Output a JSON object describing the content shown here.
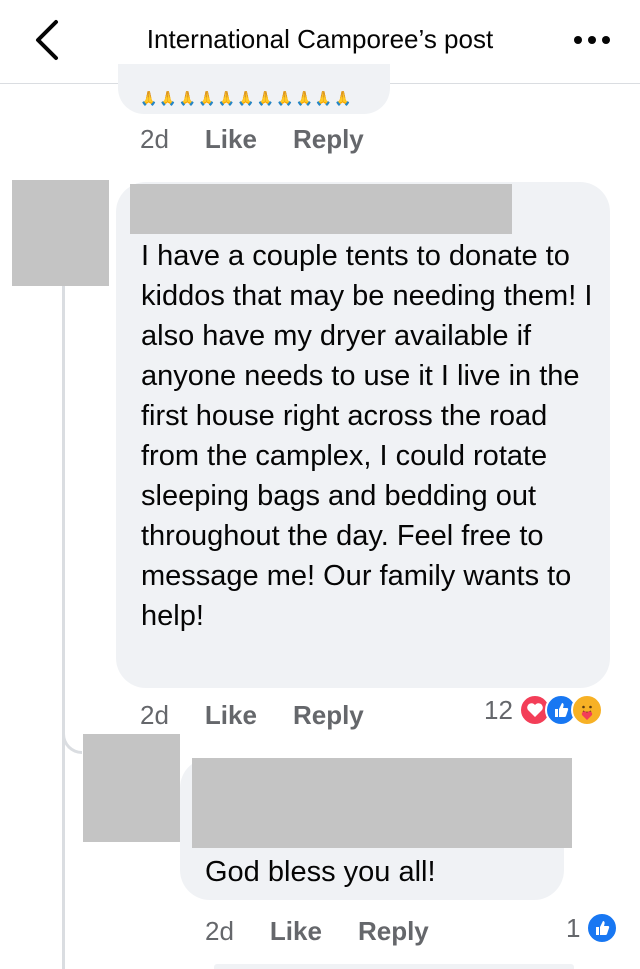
{
  "header": {
    "title": "International Camporee’s post",
    "back_icon": "chevron-left-icon",
    "more_icon": "more-horizontal-icon"
  },
  "previous_comment": {
    "emoji_row": "🙏🙏🙏🙏🙏🙏🙏🙏🙏🙏🙏",
    "time": "2d",
    "like_label": "Like",
    "reply_label": "Reply"
  },
  "main_comment": {
    "text": "I have a couple tents to donate to kiddos that may be needing them! I also have my dryer available if anyone needs to use it I live in the first house right across the road from the camplex, I could rotate sleeping bags and bedding out throughout the day. Feel free to message me! Our family wants to help!",
    "time": "2d",
    "like_label": "Like",
    "reply_label": "Reply",
    "reaction_count": "12",
    "reaction_icons": [
      "love-icon",
      "like-icon",
      "care-icon"
    ]
  },
  "reply_comment": {
    "text": "God bless you all!",
    "time": "2d",
    "like_label": "Like",
    "reply_label": "Reply",
    "reaction_count": "1",
    "reaction_icons": [
      "like-icon"
    ]
  },
  "colors": {
    "bubble": "#f0f2f5",
    "redaction": "#c4c4c4",
    "meta_text": "#65676b",
    "like_blue": "#1877f2",
    "love_red": "#f33e58",
    "care_yellow": "#f7b125"
  }
}
